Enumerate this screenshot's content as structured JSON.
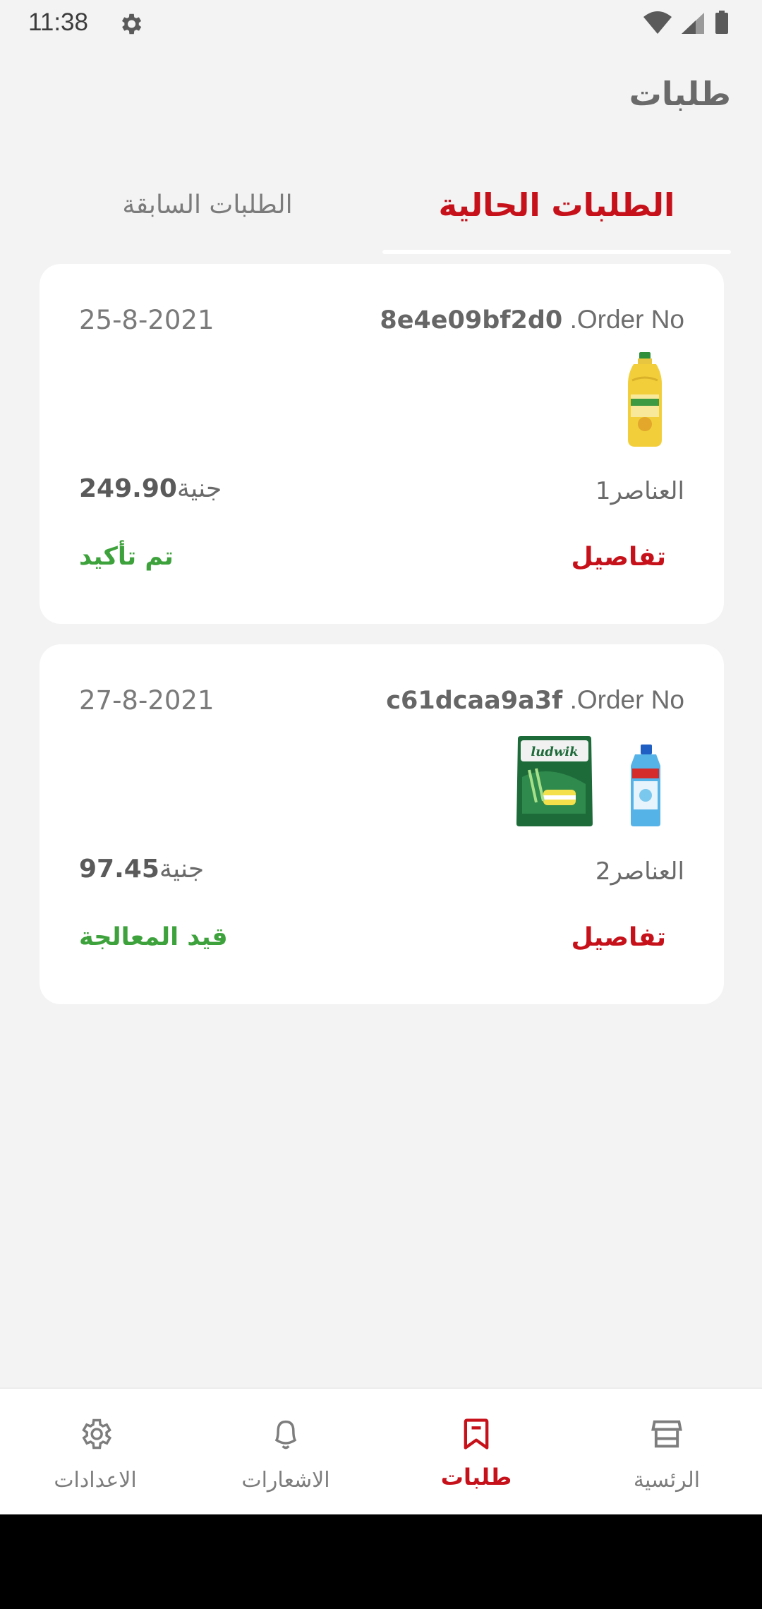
{
  "status_bar": {
    "time": "11:38"
  },
  "header": {
    "title": "طلبات"
  },
  "tabs": [
    {
      "label": "الطلبات الحالية",
      "active": true
    },
    {
      "label": "الطلبات السابقة",
      "active": false
    }
  ],
  "orders": [
    {
      "order_no_label": ".Order No",
      "order_id": "8e4e09bf2d0",
      "date": "25-8-2021",
      "items_count": "1",
      "items_label": "العناصر",
      "price": "249.90",
      "currency": "جنية",
      "details_label": "تفاصيل",
      "status": "تم تأكيد"
    },
    {
      "order_no_label": ".Order No",
      "order_id": "c61dcaa9a3f",
      "date": "27-8-2021",
      "items_count": "2",
      "items_label": "العناصر",
      "price": "97.45",
      "currency": "جنية",
      "details_label": "تفاصيل",
      "status": "قيد المعالجة"
    }
  ],
  "bottom_nav": [
    {
      "label": "الاعدادات",
      "icon": "gear-icon",
      "active": false
    },
    {
      "label": "الاشعارات",
      "icon": "bell-icon",
      "active": false
    },
    {
      "label": "طلبات",
      "icon": "orders-icon",
      "active": true
    },
    {
      "label": "الرئسية",
      "icon": "store-icon",
      "active": false
    }
  ],
  "colors": {
    "accent": "#c7111a",
    "success": "#3ea23c",
    "background": "#f3f3f3",
    "card": "#ffffff"
  }
}
